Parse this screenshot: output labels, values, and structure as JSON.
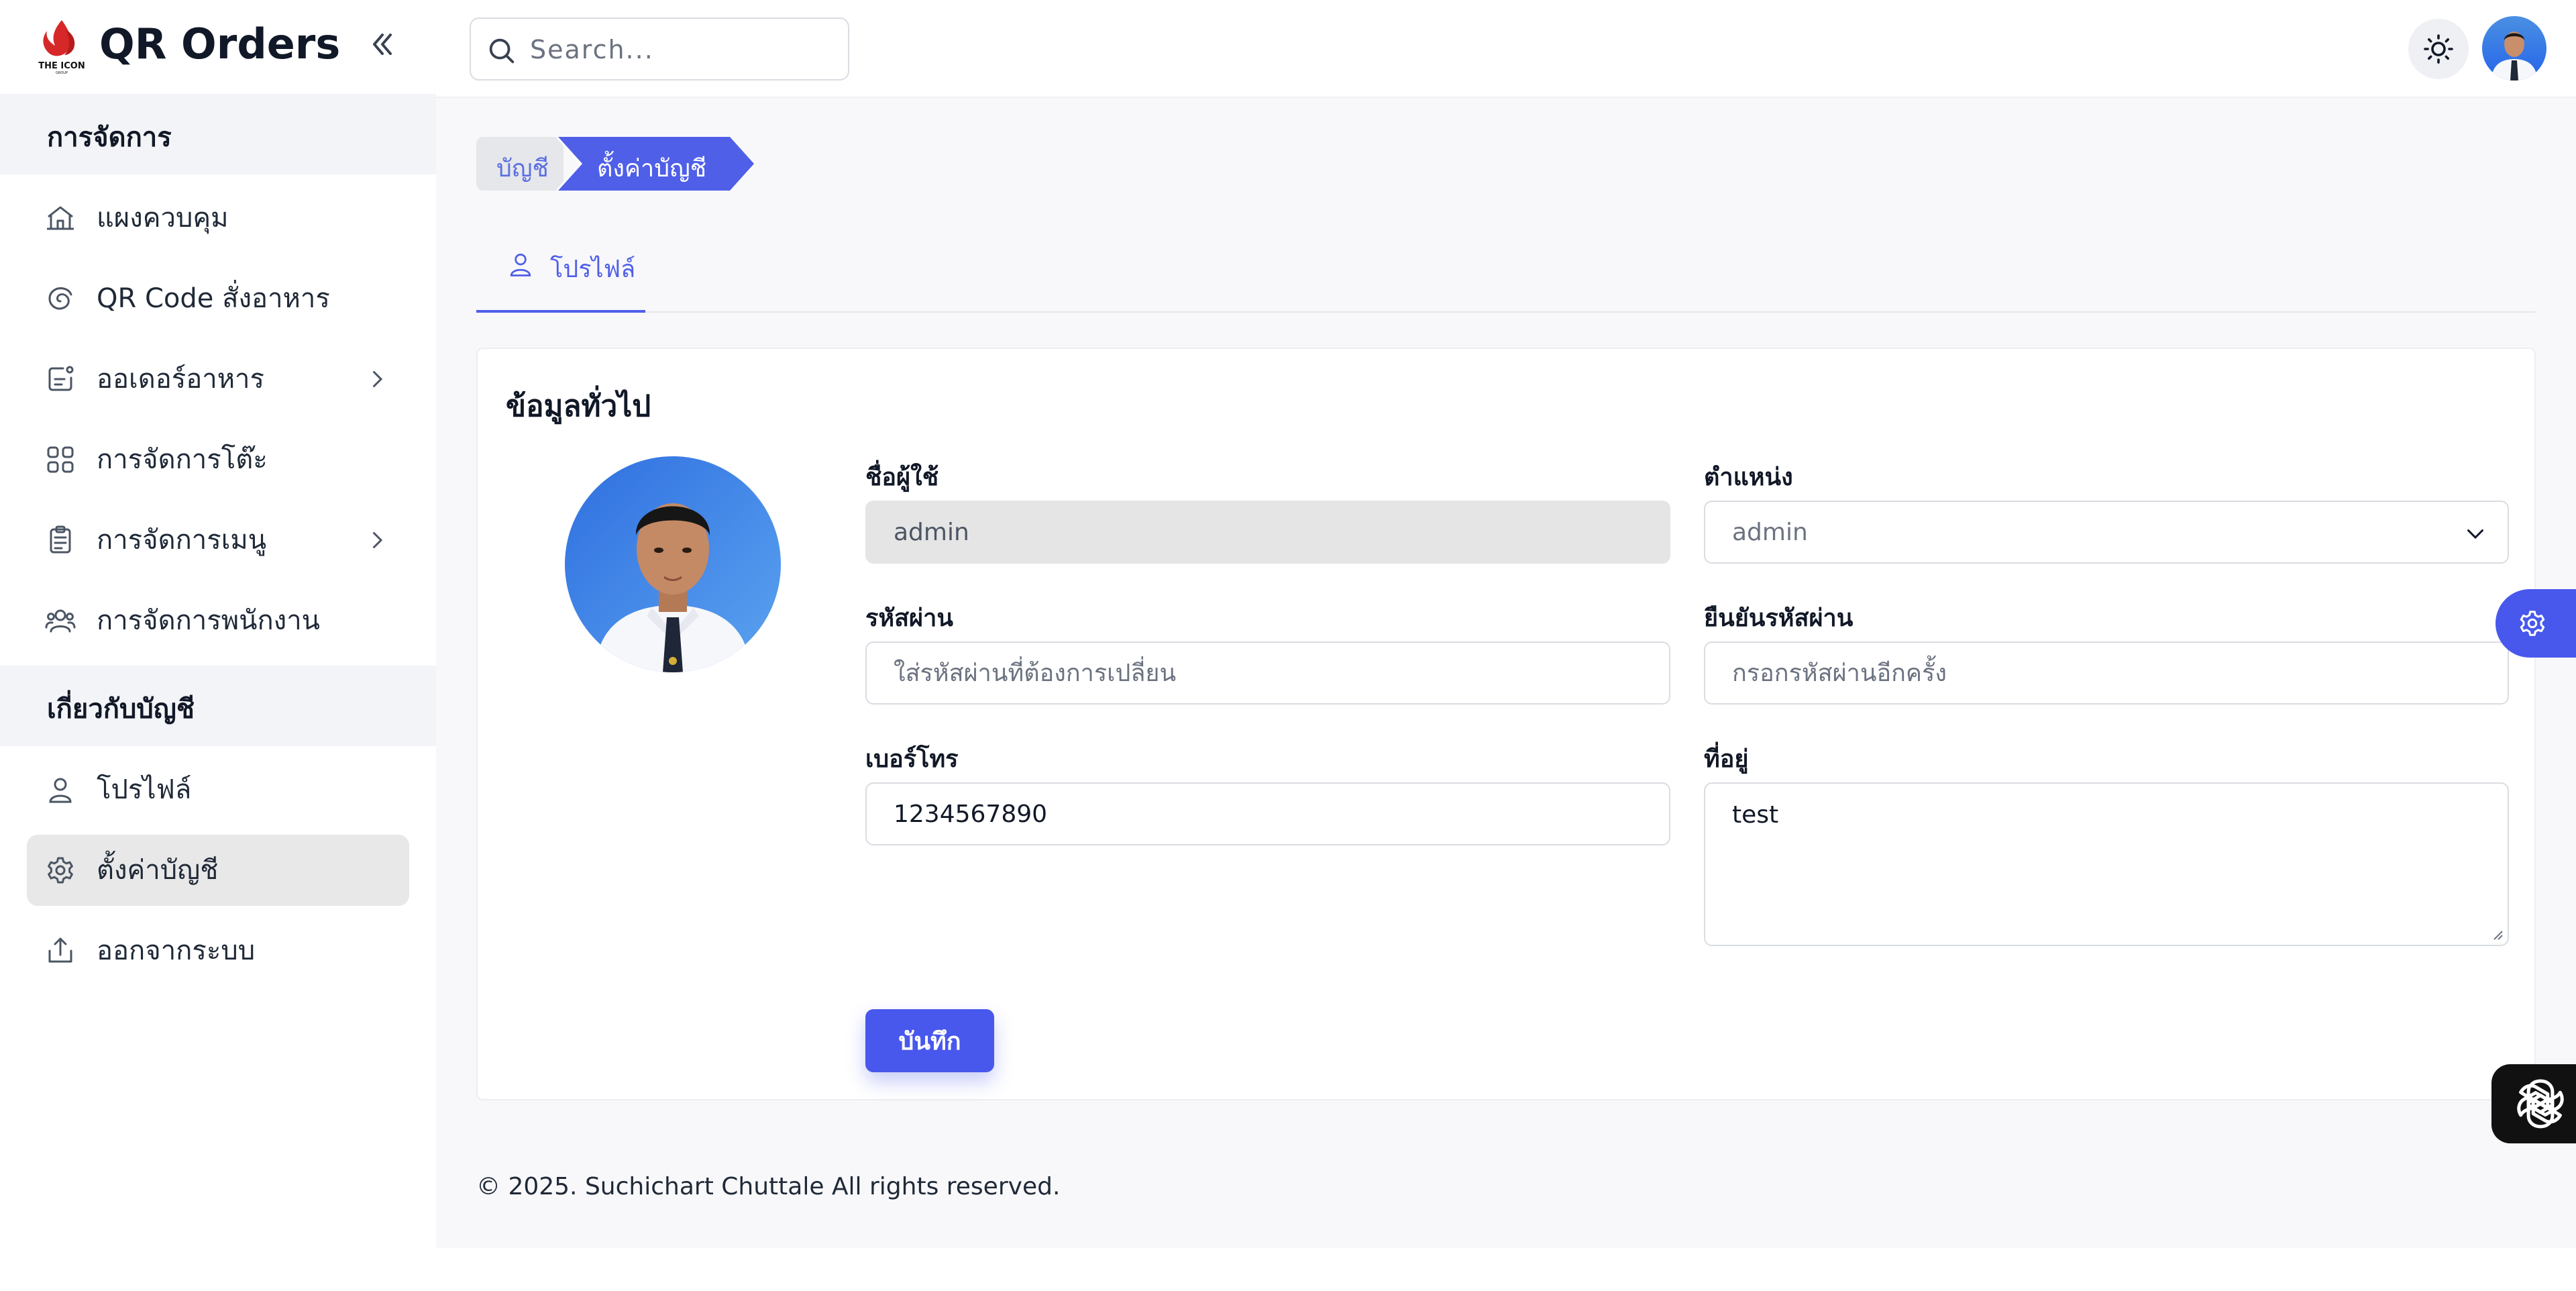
{
  "app": {
    "title": "QR Orders",
    "logo_text": "THE ICON"
  },
  "sidebar": {
    "sections": [
      {
        "title": "การจัดการ",
        "items": [
          {
            "label": "แผงควบคุม",
            "icon": "home-icon",
            "has_chevron": false
          },
          {
            "label": "QR Code สั่งอาหาร",
            "icon": "qr-swirl-icon",
            "has_chevron": false
          },
          {
            "label": "ออเดอร์อาหาร",
            "icon": "order-icon",
            "has_chevron": true
          },
          {
            "label": "การจัดการโต๊ะ",
            "icon": "grid-icon",
            "has_chevron": false
          },
          {
            "label": "การจัดการเมนู",
            "icon": "clipboard-icon",
            "has_chevron": true
          },
          {
            "label": "การจัดการพนักงาน",
            "icon": "users-icon",
            "has_chevron": false
          }
        ]
      },
      {
        "title": "เกี่ยวกับบัญชี",
        "items": [
          {
            "label": "โปรไฟล์",
            "icon": "user-icon",
            "active": false
          },
          {
            "label": "ตั้งค่าบัญชี",
            "icon": "gear-icon",
            "active": true
          },
          {
            "label": "ออกจากระบบ",
            "icon": "logout-icon",
            "active": false
          }
        ]
      }
    ]
  },
  "topbar": {
    "search_placeholder": "Search...",
    "theme_icon": "sun-icon"
  },
  "breadcrumb": [
    "บัญชี",
    "ตั้งค่าบัญชี"
  ],
  "tabs": [
    {
      "label": "โปรไฟล์",
      "icon": "user-icon",
      "active": true
    }
  ],
  "card": {
    "title": "ข้อมูลทั่วไป",
    "fields": {
      "username": {
        "label": "ชื่อผู้ใช้",
        "value": "admin",
        "disabled": true
      },
      "position": {
        "label": "ตำแหน่ง",
        "value": "admin"
      },
      "password": {
        "label": "รหัสผ่าน",
        "placeholder": "ใส่รหัสผ่านที่ต้องการเปลี่ยน"
      },
      "confirm_password": {
        "label": "ยืนยันรหัสผ่าน",
        "placeholder": "กรอกรหัสผ่านอีกครั้ง"
      },
      "phone": {
        "label": "เบอร์โทร",
        "value": "1234567890"
      },
      "address": {
        "label": "ที่อยู่",
        "value": "test"
      }
    },
    "save_label": "บันทึก"
  },
  "footer": {
    "text": "© 2025. Suchichart Chuttale All rights reserved."
  },
  "colors": {
    "accent": "#4858ec",
    "sidebar_section_bg": "#f3f4f7",
    "active_item_bg": "#e8e8e8",
    "main_bg": "#f8f8fa"
  }
}
